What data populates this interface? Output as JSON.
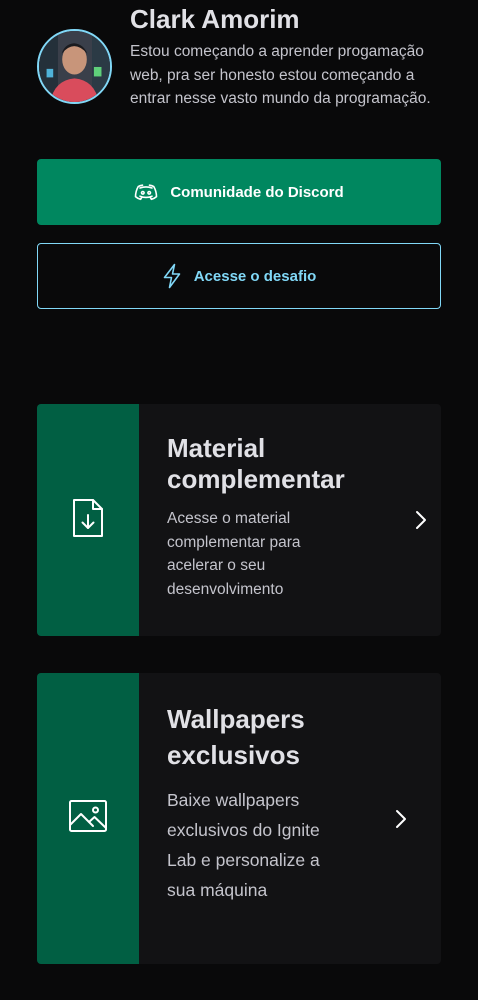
{
  "profile": {
    "name": "Clark Amorim",
    "bio": "Estou começando a aprender progamação web, pra ser honesto estou começando a entrar nesse vasto mundo da programação."
  },
  "buttons": {
    "discord": {
      "label": "Comunidade do Discord",
      "icon": "discord-icon"
    },
    "challenge": {
      "label": "Acesse o desafio",
      "icon": "lightning-icon"
    }
  },
  "cards": {
    "material": {
      "title": "Material complementar",
      "description": "Acesse o material complementar para acelerar o seu desenvolvimento",
      "icon": "file-download-icon"
    },
    "wallpapers": {
      "title": "Wallpapers exclusivos",
      "description": "Baixe wallpapers exclusivos do Ignite Lab e personalize a sua máquina",
      "icon": "image-icon"
    }
  },
  "colors": {
    "background": "#09090a",
    "card": "#121214",
    "green": "#00875f",
    "green_dark": "#015f43",
    "blue": "#81d8f7",
    "text": "#e1e1e6",
    "text_muted": "#c4c4cc"
  }
}
